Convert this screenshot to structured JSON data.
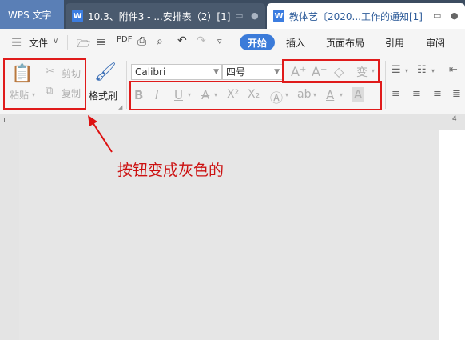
{
  "tabs": {
    "app": "WPS 文字",
    "doc1": "10.3、附件3 - ...安排表（2）[1]",
    "doc2": "教体艺〔2020...工作的通知[1]",
    "doc_icon": "W"
  },
  "menu": {
    "file": "文件",
    "start": "开始",
    "insert": "插入",
    "layout": "页面布局",
    "reference": "引用",
    "review": "审阅"
  },
  "ribbon": {
    "paste": "粘贴",
    "cut": "剪切",
    "copy": "复制",
    "format_painter": "格式刷",
    "font_name": "Calibri",
    "font_size": "四号",
    "ruler_number": "4"
  },
  "annotation": "按钮变成灰色的",
  "colors": {
    "accent": "#3b7bd9",
    "annotation_red": "#cc1111",
    "disabled_gray": "#b0b0b0",
    "tabbar": "#3c4c60"
  }
}
